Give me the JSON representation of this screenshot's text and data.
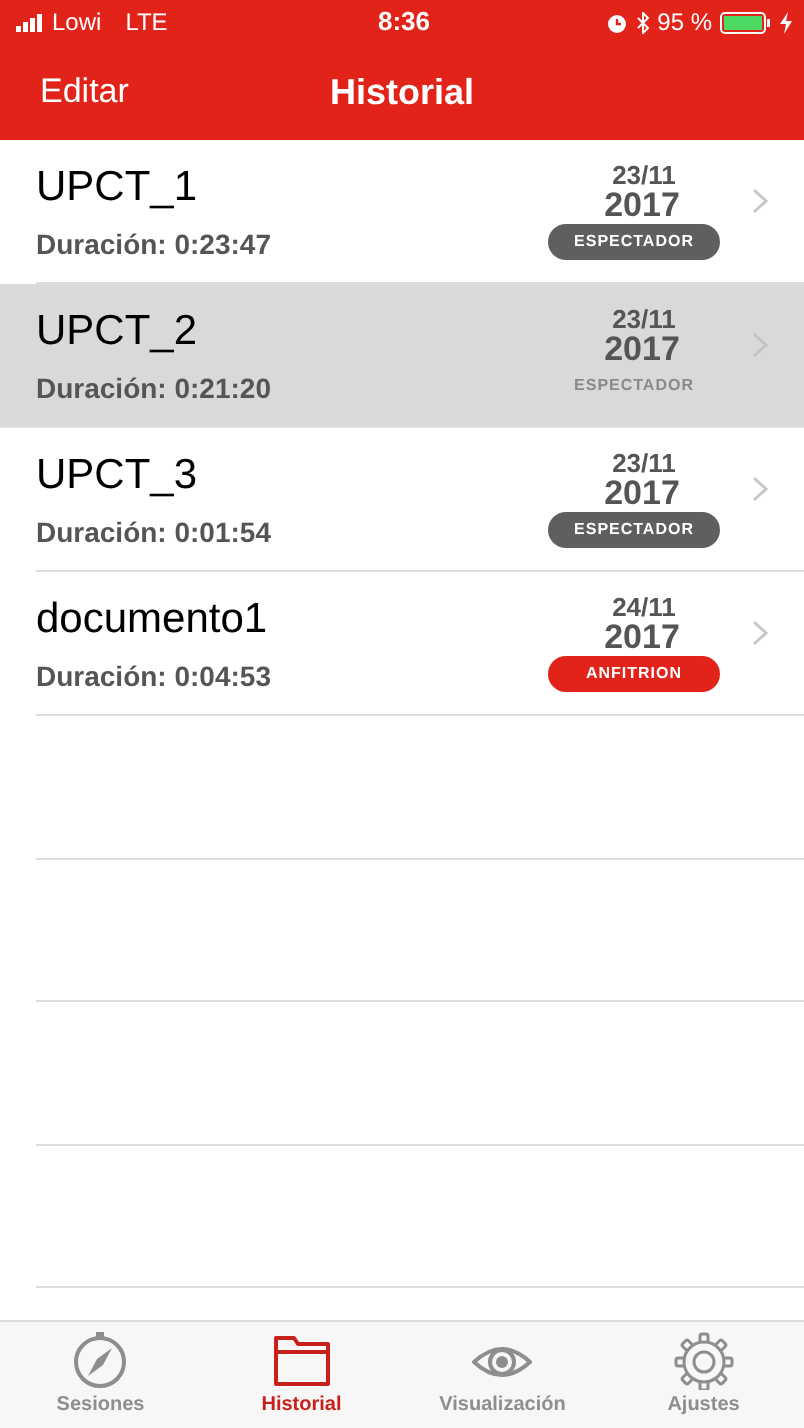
{
  "status_bar": {
    "carrier": "Lowi",
    "network": "LTE",
    "time": "8:36",
    "battery": "95 %"
  },
  "nav_bar": {
    "left_button": "Editar",
    "title": "Historial"
  },
  "sessions": [
    {
      "name": "UPCT_1",
      "duration": "Duración: 0:23:47",
      "day": "23/11",
      "year": "2017",
      "role": "ESPECTADOR",
      "kind": "espectador",
      "selected": false
    },
    {
      "name": "UPCT_2",
      "duration": "Duración: 0:21:20",
      "day": "23/11",
      "year": "2017",
      "role": "ESPECTADOR",
      "kind": "espectador",
      "selected": true
    },
    {
      "name": "UPCT_3",
      "duration": "Duración: 0:01:54",
      "day": "23/11",
      "year": "2017",
      "role": "ESPECTADOR",
      "kind": "espectador",
      "selected": false
    },
    {
      "name": "documento1",
      "duration": "Duración: 0:04:53",
      "day": "24/11",
      "year": "2017",
      "role": "ANFITRION",
      "kind": "anfitrion",
      "selected": false
    }
  ],
  "tab_bar": [
    {
      "label": "Sesiones",
      "selected": false
    },
    {
      "label": "Historial",
      "selected": true
    },
    {
      "label": "Visualización",
      "selected": false
    },
    {
      "label": "Ajustes",
      "selected": false
    }
  ]
}
